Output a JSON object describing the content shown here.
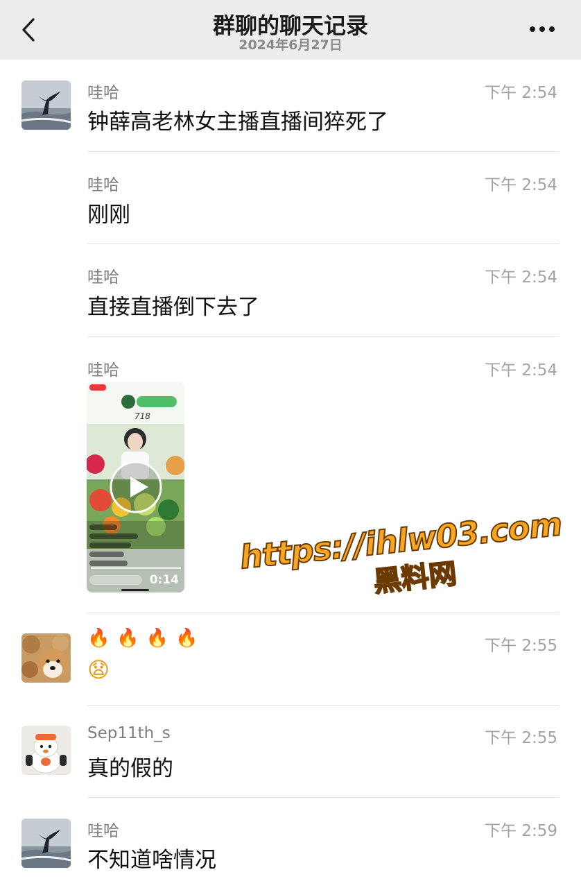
{
  "header": {
    "title": "群聊的聊天记录",
    "date": "2024年6月27日"
  },
  "messages": [
    {
      "sender": "哇哈",
      "time": "下午 2:54",
      "text": "钟薛高老林女主播直播间猝死了"
    },
    {
      "sender": "哇哈",
      "time": "下午 2:54",
      "text": "刚刚"
    },
    {
      "sender": "哇哈",
      "time": "下午 2:54",
      "text": "直接直播倒下去了"
    },
    {
      "sender": "哇哈",
      "time": "下午 2:54",
      "video_duration": "0:14",
      "video_count": "718"
    },
    {
      "sender": "",
      "time": "下午 2:55",
      "text": "🔥🔥🔥🔥",
      "text2": "😧"
    },
    {
      "sender": "Sep11th_s",
      "time": "下午 2:55",
      "text": "真的假的"
    },
    {
      "sender": "哇哈",
      "time": "下午 2:59",
      "text": "不知道啥情况"
    }
  ],
  "watermark": {
    "url": "https://ihlw03.com",
    "name": "黑料网"
  },
  "colors": {
    "header_bg": "#ededed",
    "watermark": "#f7a623"
  }
}
